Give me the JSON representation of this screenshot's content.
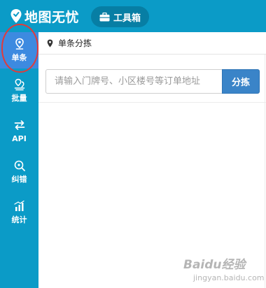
{
  "header": {
    "app_title": "地图无忧",
    "toolbox_label": "工具箱"
  },
  "sidebar": {
    "items": [
      {
        "label": "单条",
        "icon": "pin-cursor-icon",
        "active": true
      },
      {
        "label": "批量",
        "icon": "multi-pin-icon",
        "active": false
      },
      {
        "label": "API",
        "icon": "swap-arrows-icon",
        "active": false
      },
      {
        "label": "纠错",
        "icon": "search-pin-icon",
        "active": false
      },
      {
        "label": "统计",
        "icon": "bar-chart-icon",
        "active": false
      }
    ]
  },
  "breadcrumb": {
    "label": "单条分拣"
  },
  "search": {
    "placeholder": "请输入门牌号、小区楼号等订单地址",
    "value": "",
    "button_label": "分拣"
  },
  "watermark": {
    "brand": "Baidu经验",
    "sub": "jingyan.baidu.com"
  },
  "colors": {
    "topbar": "#0b9bc7",
    "sidebar": "#0b9bc7",
    "active_item": "#3d8ae0",
    "search_button": "#3a84c8",
    "highlight_ring": "#e23a3a"
  }
}
